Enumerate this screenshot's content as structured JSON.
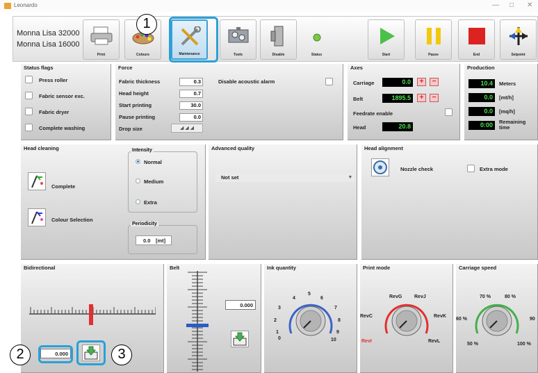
{
  "window": {
    "title": "Leonardo",
    "min": "—",
    "max": "□",
    "close": "✕"
  },
  "machines": [
    "Monna Lisa 32000",
    "Monna Lisa 16000"
  ],
  "toolbar": [
    {
      "label": "Print",
      "icon": "printer-icon"
    },
    {
      "label": "Colours",
      "icon": "palette-icon"
    },
    {
      "label": "Maintenance",
      "icon": "tools-icon",
      "selected": true
    },
    {
      "label": "Tools",
      "icon": "toolbox-icon"
    },
    {
      "label": "Disable",
      "icon": "disable-icon"
    },
    {
      "label": "Status",
      "icon": "status-led-icon"
    },
    {
      "label": "Start",
      "icon": "play-icon"
    },
    {
      "label": "Pause",
      "icon": "pause-icon"
    },
    {
      "label": "End",
      "icon": "stop-icon"
    },
    {
      "label": "Setpoint",
      "icon": "setpoint-icon"
    }
  ],
  "callouts": [
    "1",
    "2",
    "3"
  ],
  "status_flags": {
    "title": "Status flags",
    "items": [
      "Press roller",
      "Fabric sensor exc.",
      "Fabric dryer",
      "Complete washing"
    ]
  },
  "force": {
    "title": "Force",
    "rows": [
      {
        "label": "Fabric thickness",
        "value": "0.3"
      },
      {
        "label": "Head height",
        "value": "0.7"
      },
      {
        "label": "Start printing",
        "value": "30.0"
      },
      {
        "label": "Pause printing",
        "value": "0.0"
      }
    ],
    "drop_size": "Drop size",
    "disable_alarm": "Disable acoustic alarm"
  },
  "axes": {
    "title": "Axes",
    "carriage_label": "Carriage",
    "carriage": "0.0",
    "belt_label": "Belt",
    "belt": "1895.5",
    "feedrate": "Feedrate enable",
    "head_label": "Head",
    "head": "20.8"
  },
  "production": {
    "title": "Production",
    "rows": [
      {
        "value": "10.4",
        "unit": "Meters"
      },
      {
        "value": "0.0",
        "unit": "[mt/h]"
      },
      {
        "value": "0.0",
        "unit": "[mq/h]"
      },
      {
        "value": "0:00",
        "unit": "Remaining time"
      }
    ]
  },
  "head_cleaning": {
    "title": "Head cleaning",
    "complete": "Complete",
    "colour_selection": "Colour Selection",
    "intensity": "Intensity",
    "options": [
      "Normal",
      "Medium",
      "Extra"
    ],
    "selected": 0,
    "periodicity": "Periodicity",
    "period_value": "0.0",
    "period_unit": "[mt]"
  },
  "advanced_quality": {
    "title": "Advanced quality",
    "value": "Not set"
  },
  "head_alignment": {
    "title": "Head alignment",
    "nozzle": "Nozzle check",
    "extra": "Extra mode"
  },
  "bidirectional": {
    "title": "Bidirectional",
    "value": "0.000"
  },
  "belt": {
    "title": "Belt",
    "value": "0.000"
  },
  "ink_quantity": {
    "title": "Ink quantity",
    "ticks": [
      "0",
      "1",
      "2",
      "3",
      "4",
      "5",
      "6",
      "7",
      "8",
      "9",
      "10"
    ]
  },
  "print_mode": {
    "title": "Print mode",
    "labels": [
      "RevG",
      "RevJ",
      "RevC",
      "RevK",
      "RevI",
      "RevL"
    ]
  },
  "carriage_speed": {
    "title": "Carriage speed",
    "labels": [
      "70 %",
      "80 %",
      "60 %",
      "90",
      "50 %",
      "100 %"
    ]
  },
  "colors": {
    "accent": "#2aa0d8",
    "lcd_green": "#4fe04f",
    "gauge_blue": "#3a63c9",
    "gauge_red": "#e23030",
    "gauge_green": "#43b04a"
  }
}
